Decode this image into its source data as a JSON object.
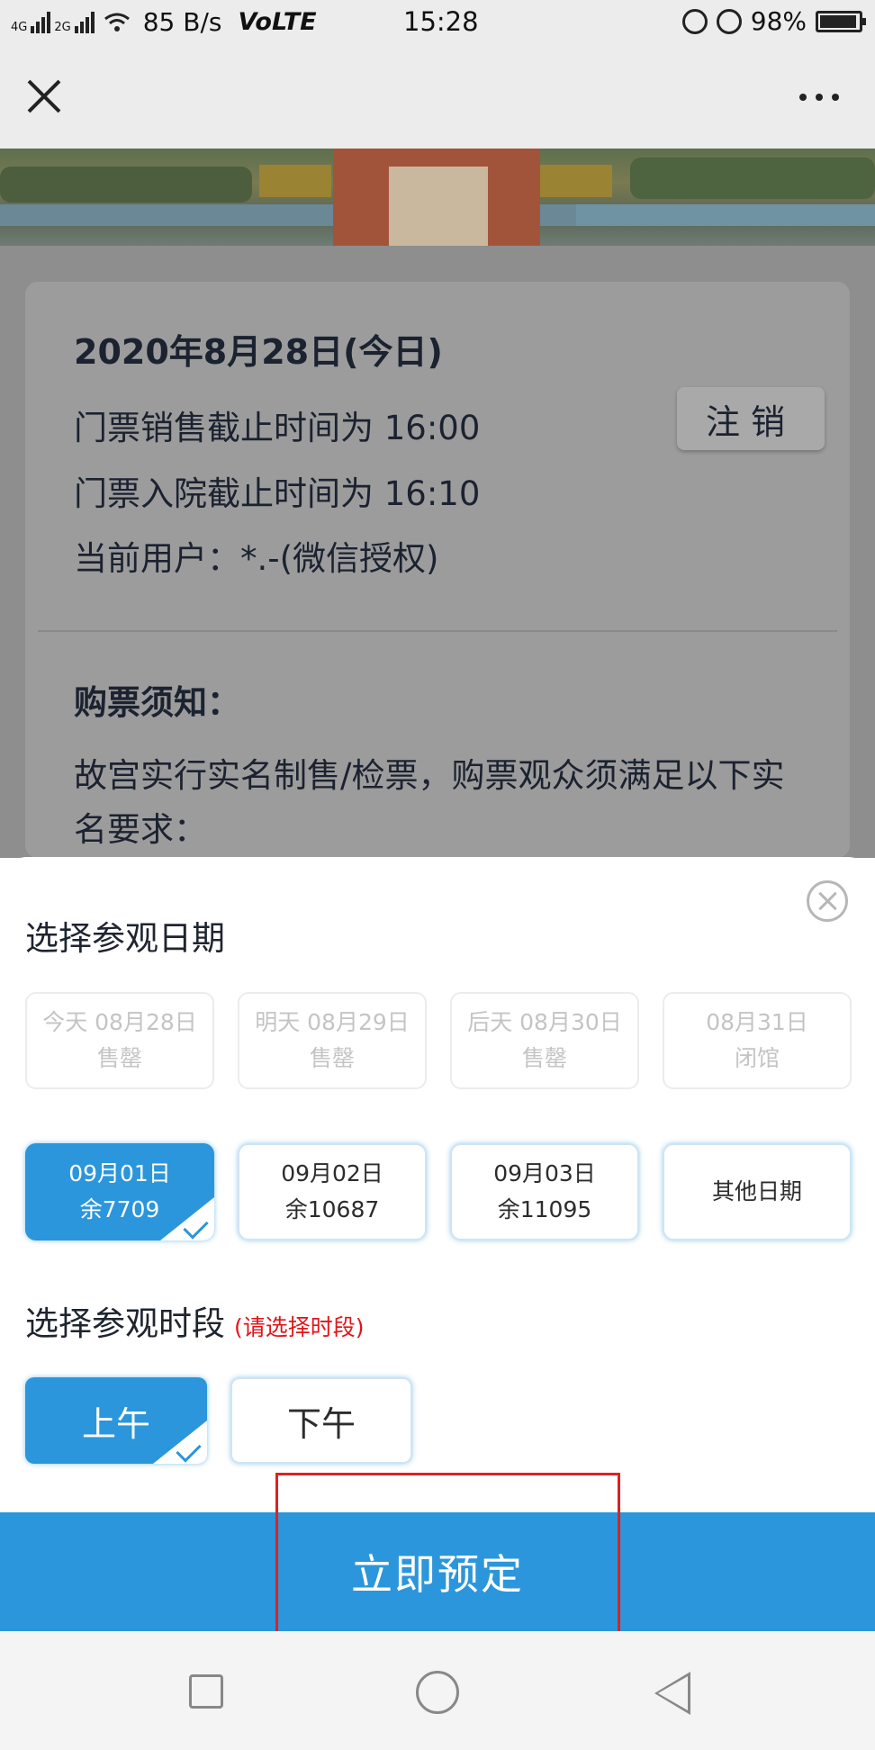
{
  "status_bar": {
    "network_label_top": "4G",
    "network_label_bottom": "2G",
    "speed": "85 B/s",
    "volte": "VoLTE",
    "time": "15:28",
    "battery": "98%",
    "icons": [
      "signal-icon",
      "wifi-icon",
      "lock-rotation-icon",
      "alarm-icon",
      "battery-icon"
    ]
  },
  "header": {
    "close_icon": "close-icon",
    "more_icon": "more-icon"
  },
  "info": {
    "date_title": "2020年8月28日(今日)",
    "sale_deadline": "门票销售截止时间为  16:00",
    "entry_deadline": "门票入院截止时间为  16:10",
    "current_user": "当前用户：*.-(微信授权)",
    "logout_label": "注销",
    "notice_heading": "购票须知：",
    "notice_text": "故宫实行实名制售/检票，购票观众须满足以下实名要求："
  },
  "sheet": {
    "date_section_title": "选择参观日期",
    "dates": [
      {
        "line1": "今天 08月28日",
        "line2": "售罄",
        "state": "disabled"
      },
      {
        "line1": "明天 08月29日",
        "line2": "售罄",
        "state": "disabled"
      },
      {
        "line1": "后天 08月30日",
        "line2": "售罄",
        "state": "disabled"
      },
      {
        "line1": "08月31日",
        "line2": "闭馆",
        "state": "disabled"
      },
      {
        "line1": "09月01日",
        "line2": "余7709",
        "state": "selected"
      },
      {
        "line1": "09月02日",
        "line2": "余10687",
        "state": "open"
      },
      {
        "line1": "09月03日",
        "line2": "余11095",
        "state": "open"
      },
      {
        "line1": "其他日期",
        "line2": "",
        "state": "open"
      }
    ],
    "time_section_title": "选择参观时段",
    "time_hint": "(请选择时段)",
    "time_slots": [
      {
        "label": "上午",
        "state": "selected"
      },
      {
        "label": "下午",
        "state": "open"
      }
    ],
    "book_button": "立即预定"
  },
  "colors": {
    "accent": "#2b96db",
    "hint_red": "#e0161b",
    "highlight_outline": "#e02020"
  }
}
